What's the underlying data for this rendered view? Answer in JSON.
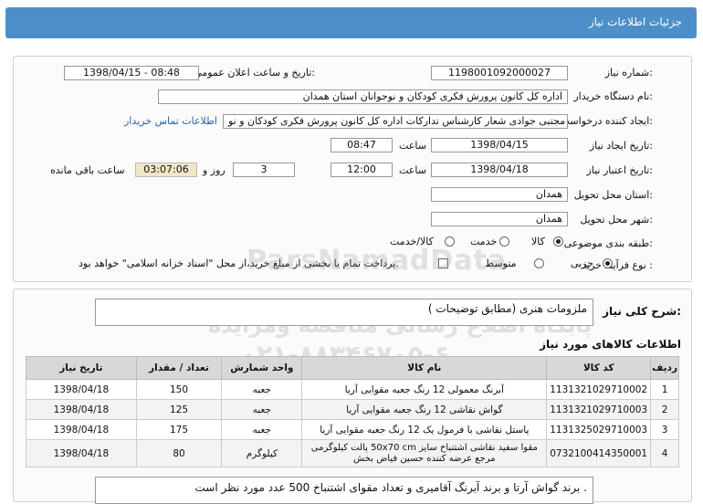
{
  "header": {
    "title": "جزئیات اطلاعات نیاز"
  },
  "fields": {
    "need_number_label": "شماره نیاز:",
    "need_number": "1198001092000027",
    "announce_label": "تاریخ و ساعت اعلان عمومی:",
    "announce_value": "1398/04/15 - 08:48",
    "buyer_label": "نام دستگاه خریدار:",
    "buyer": "اداره کل کانون پرورش فکری کودکان و نوجوانان استان همدان",
    "requester_label": "ایجاد کننده درخواست:",
    "requester": "مجتبی جوادی شعار کارشناس تدارکات اداره کل کانون پرورش فکری کودکان و نو",
    "contact_link": "اطلاعات تماس خریدار",
    "created_label": "تاریخ ایجاد نیاز:",
    "created_date": "1398/04/15",
    "time_label": "ساعت",
    "created_time": "08:47",
    "valid_label": "تاریخ اعتبار نیاز:",
    "valid_date": "1398/04/18",
    "valid_time": "12:00",
    "days": "3",
    "days_label": "روز و",
    "remaining": "03:07:06",
    "remaining_label": "ساعت باقی مانده",
    "province_label": "استان محل تحویل:",
    "province": "همدان",
    "city_label": "شهر محل تحویل:",
    "city": "همدان",
    "category_label": "طبقه بندی موضوعی:",
    "category_options": [
      "کالا",
      "خدمت",
      "کالا/خدمت"
    ],
    "process_label": "نوع فرآیند خرید :",
    "process_options": [
      "جزیی",
      "متوسط"
    ],
    "payment_text": "پرداخت تمام یا بخشی از مبلغ خرید،از محل \"اسناد خزانه اسلامی\" خواهد بود."
  },
  "description": {
    "label": "شرح کلی نیاز:",
    "value": "ملزومات هنری (مطابق توضیحات )"
  },
  "goods": {
    "heading": "اطلاعات کالاهای مورد نیاز",
    "columns": [
      "ردیف",
      "کد کالا",
      "نام کالا",
      "واحد شمارش",
      "تعداد / مقدار",
      "تاریخ نیاز"
    ],
    "rows": [
      [
        "1",
        "1131321029710002",
        "آبرنگ معمولی 12 رنگ جعبه مقوایی آریا",
        "جعبه",
        "150",
        "1398/04/18"
      ],
      [
        "2",
        "1131321029710003",
        "گواش نقاشی 12 رنگ جعبه مقوایی آریا",
        "جعبه",
        "125",
        "1398/04/18"
      ],
      [
        "3",
        "1131325029710003",
        "پاستل نقاشی با فرمول یک 12 رنگ جعبه مقوایی آریا",
        "جعبه",
        "175",
        "1398/04/18"
      ],
      [
        "4",
        "0732100414350001",
        "مقوا سفید نقاشی اشتنباخ سایز 50x70 cm پالت کیلوگرمی مرجع عرضه کننده حسین فیاض بخش",
        "کیلوگرم",
        "80",
        "1398/04/18"
      ]
    ]
  },
  "note": "برند گواش آرتا و برند آبرنگ آقامیری و تعداد مقوای اشتنباخ 500 عدد مورد نظر است .",
  "watermark": {
    "brand": "ParsNamadData",
    "line1": "پایگاه اطلاع رسانی مناقصه ومزایده",
    "phone": "۰۲۱-۸۸۳۴۶۷۰۵-۶"
  }
}
